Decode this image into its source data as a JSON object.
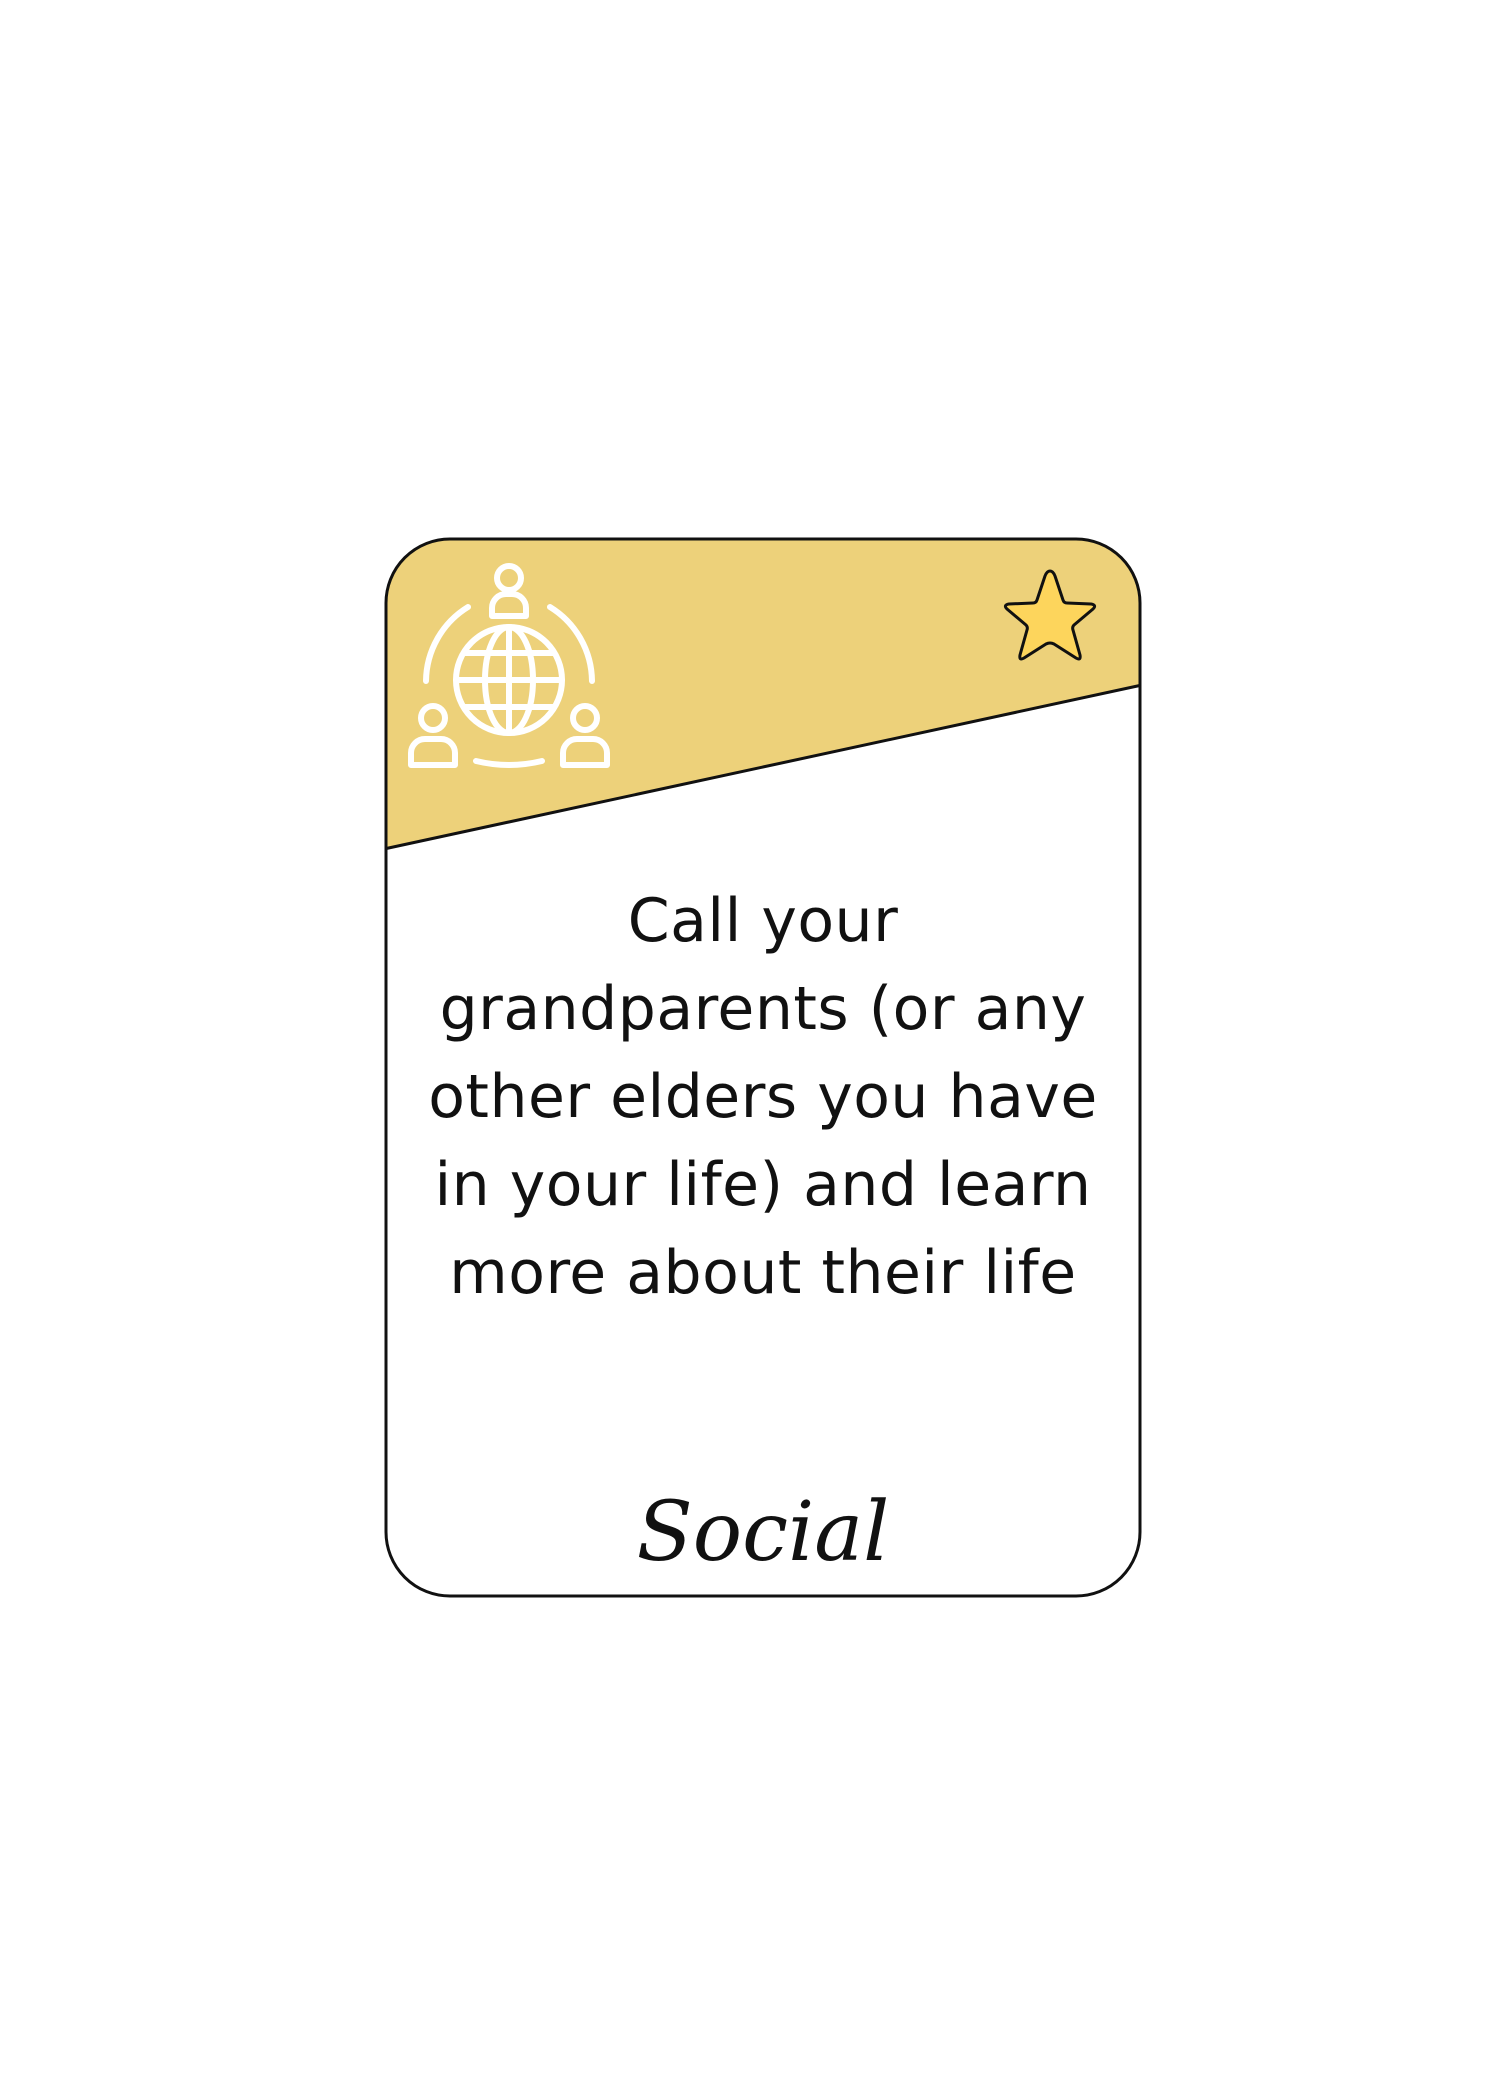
{
  "card": {
    "header_color": "#EDD17A",
    "star_fill": "#FDD55C",
    "border_color": "#111111",
    "icon": "people-globe-icon",
    "badge_icon": "star-icon",
    "prompt": "Call your grandparents (or any other elders you have in your life) and learn more about their life",
    "category": "Social"
  }
}
